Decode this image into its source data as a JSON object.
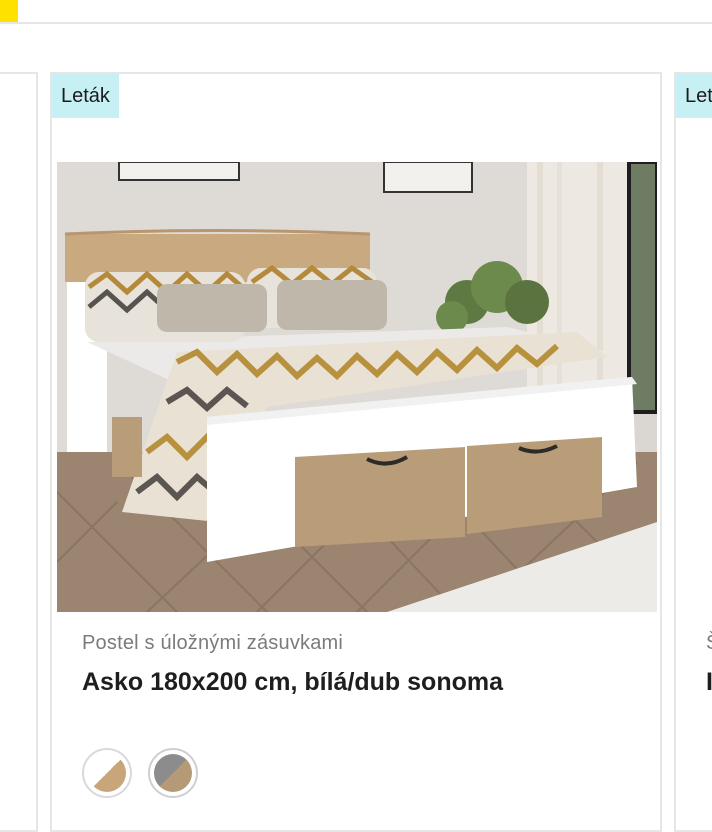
{
  "header": {
    "accent_color": "#ffe100"
  },
  "product": {
    "badge": "Leták",
    "subtitle": "Postel s úložnými zásuvkami",
    "title": "Asko 180x200 cm, bílá/dub sonoma",
    "image_alt": "Bed with storage drawers, white and sonoma oak",
    "swatches": [
      {
        "name": "white-oak",
        "colors": [
          "#ffffff",
          "#c9a57a"
        ]
      },
      {
        "name": "grey-oak",
        "colors": [
          "#8c8c8c",
          "#b49a76"
        ]
      }
    ]
  },
  "next_card": {
    "badge": "Let",
    "subtitle_start": "Š",
    "title_start": "I"
  },
  "colors": {
    "badge_bg": "#c6f0f4",
    "border": "#e6e6e6"
  }
}
